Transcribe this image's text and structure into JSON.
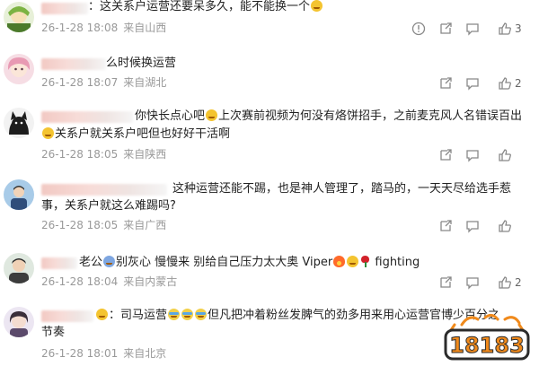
{
  "comments": [
    {
      "text_lines": [
        "：这关系户运营还要呆多久，能不能换一个"
      ],
      "date": "26-1-28 18:08",
      "location": "来自山西",
      "likes": "3",
      "actions": [
        "warning-icon",
        "share-icon",
        "reply-icon",
        "repost-icon",
        "like-icon"
      ]
    },
    {
      "text_lines": [
        "么时候换运营"
      ],
      "date": "26-1-28 18:07",
      "location": "来自湖北",
      "likes": "2",
      "actions": [
        "share-icon",
        "reply-icon",
        "repost-icon",
        "like-icon"
      ]
    },
    {
      "text_lines": [
        "你快长点心吧",
        "上次赛前视频为何没有烙饼招手，之前麦克风人名错误百出",
        "关系户就关系户吧但也好好干活啊"
      ],
      "date": "26-1-28 18:05",
      "location": "来自陕西",
      "likes": "",
      "actions": [
        "share-icon",
        "reply-icon",
        "repost-icon",
        "like-icon"
      ]
    },
    {
      "text_lines": [
        "这种运营还能不踢，也是神人管理了，踏马的，一天天尽给选手惹",
        "事，关系户就这么难踢吗?"
      ],
      "date": "26-1-28 18:05",
      "location": "来自广西",
      "likes": "",
      "actions": [
        "share-icon",
        "reply-icon",
        "repost-icon",
        "like-icon"
      ]
    },
    {
      "text_lines": [
        "老公",
        "别灰心 慢慢来 别给自己压力太大奥 Viper",
        "fighting"
      ],
      "date": "26-1-28 18:04",
      "location": "来自内蒙古",
      "likes": "2",
      "actions": [
        "share-icon",
        "reply-icon",
        "repost-icon",
        "like-icon"
      ]
    },
    {
      "text_lines": [
        "：司马运营",
        "但凡把冲着粉丝发脾气的劲多用来用心运营官博少百分之",
        "节奏"
      ],
      "date": "26-1-28 18:01",
      "location": "来自北京",
      "likes": "",
      "actions": [
        "share-icon",
        "reply-icon",
        "repost-icon",
        "like-icon"
      ]
    }
  ],
  "watermark": "18183",
  "colors": {
    "meta": "#999999",
    "text": "#222222",
    "logo_orange": "#f08a1c",
    "logo_dark": "#2b2b2b"
  }
}
